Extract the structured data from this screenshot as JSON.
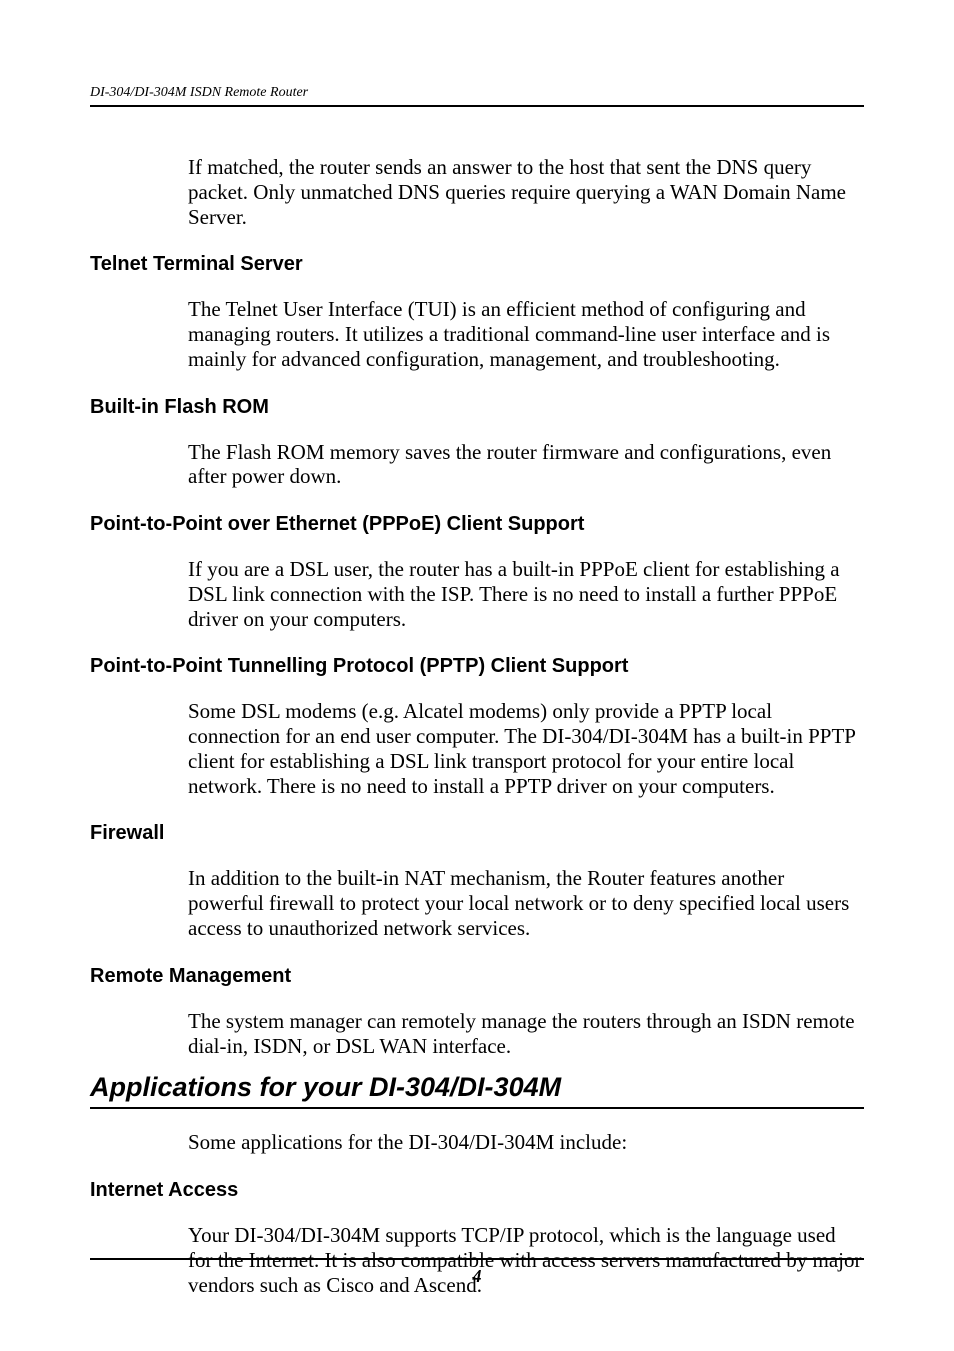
{
  "header": {
    "running_title": "DI-304/DI-304M ISDN Remote Router"
  },
  "intro_paragraph": "If matched, the router sends an answer to the host that sent the DNS query packet. Only unmatched DNS queries require querying a WAN Domain Name Server.",
  "sections": [
    {
      "heading": "Telnet Terminal Server",
      "body": "The Telnet User Interface (TUI) is an efficient method of configuring and managing routers. It utilizes a traditional command-line user interface and is mainly for advanced configuration, management, and troubleshooting."
    },
    {
      "heading": "Built-in Flash ROM",
      "body": "The Flash ROM memory saves the router firmware and configurations, even after power down."
    },
    {
      "heading": "Point-to-Point over Ethernet (PPPoE) Client Support",
      "body": "If you are a DSL user, the router has a built-in PPPoE client for establishing a DSL link connection with the ISP. There is no need to install a further PPPoE driver on your computers."
    },
    {
      "heading": "Point-to-Point Tunnelling Protocol (PPTP) Client Support",
      "body": "Some DSL modems (e.g. Alcatel modems) only provide a PPTP local connection for an end user computer. The DI-304/DI-304M has a built-in PPTP client for establishing a DSL link transport protocol for your entire local network. There is no need to install a PPTP driver on your computers."
    },
    {
      "heading": "Firewall",
      "body": "In addition to the built-in NAT mechanism, the Router features another powerful firewall to protect your local network or to deny specified local users access to unauthorized network services."
    },
    {
      "heading": "Remote Management",
      "body": "The system manager can remotely manage the routers through an ISDN remote dial-in, ISDN, or DSL WAN interface."
    }
  ],
  "chapter": {
    "title": "Applications for your DI-304/DI-304M",
    "intro": "Some applications for the DI-304/DI-304M include:",
    "sections": [
      {
        "heading": "Internet Access",
        "body": "Your DI-304/DI-304M supports TCP/IP protocol, which is the language used for the Internet. It is also compatible with access servers manufactured by major vendors such as Cisco and Ascend."
      }
    ]
  },
  "footer": {
    "page_number": "4"
  }
}
